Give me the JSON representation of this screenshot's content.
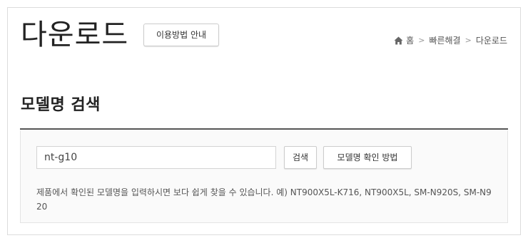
{
  "header": {
    "title": "다운로드",
    "guide_button": "이용방법 안내"
  },
  "breadcrumb": {
    "home_icon": "home-icon",
    "items": [
      "홈",
      "빠른해결",
      "다운로드"
    ],
    "separator": ">"
  },
  "search": {
    "section_title": "모델명 검색",
    "input_value": "nt-g10",
    "search_button": "검색",
    "howto_button": "모델명 확인 방법",
    "hint": "제품에서 확인된 모델명을 입력하시면 보다 쉽게 찾을 수 있습니다. 예) NT900X5L-K716, NT900X5L, SM-N920S, SM-N920"
  }
}
